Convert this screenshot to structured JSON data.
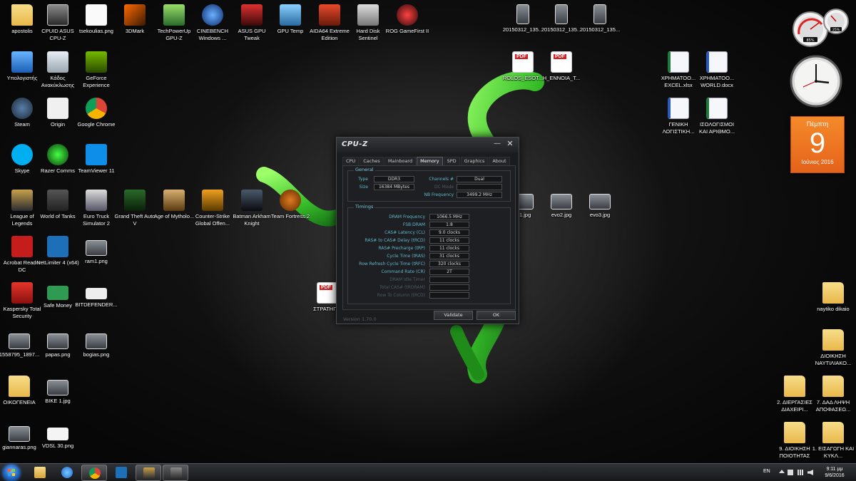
{
  "desktop_icons": {
    "apostolis": "apostolis",
    "cpuid": "CPUID ASUS CPU-Z",
    "tsekoulias": "tsekoulias.png",
    "mark3d": "3DMark",
    "gpuz": "TechPowerUp GPU-Z",
    "cinebench": "CINEBENCH Windows ...",
    "asusgpu": "ASUS GPU Tweak",
    "gputemp": "GPU Temp",
    "aida": "AIDA64 Extreme Edition",
    "hds": "Hard Disk Sentinel",
    "rog": "ROG GameFirst II",
    "img1": "20150312_135...",
    "img2": "20150312_135...",
    "img3": "20150312_135...",
    "computer": "Υπολογιστής",
    "recycle": "Κάδος Ανακύκλωσης",
    "geforce": "GeForce Experience",
    "rolos": "ROLOS_ESOT...",
    "ennoia": "H_ENNOIA_T...",
    "xrim_excel": "ΧΡΗΜΑΤΟΟ... EXCEL.xlsx",
    "xrim_word": "ΧΡΗΜΑΤΟΟ... WORLD.docx",
    "steam": "Steam",
    "origin": "Origin",
    "chrome": "Google Chrome",
    "geniki": "ΓΕΝΙΚΗ ΛΟΓΙΣΤΙΚΗ...",
    "isologismoi": "ΙΣΟΛΟΓΙΣΜΟΙ ΚΑΙ ΑΡΙΘΜΟ...",
    "skype": "Skype",
    "razer": "Razer Comms",
    "teamviewer": "TeamViewer 11",
    "lol": "League of Legends",
    "wot": "World of Tanks",
    "ets": "Euro Truck Simulator 2",
    "gta": "Grand Theft Auto V",
    "aom": "Age of Mytholo...",
    "csgo": "Counter-Strike Global Offen...",
    "batman": "Batman Arkham Knight",
    "tf2": "Team Fortress 2",
    "evo1": "...1.jpg",
    "evo2": "evo2.jpg",
    "evo3": "evo3.jpg",
    "acrobat": "Acrobat Reader DC",
    "netlimiter": "NetLimiter 4 (x64)",
    "ram1": "ram1.png",
    "kaspersky": "Kaspersky Total Security",
    "safemoney": "Safe Money",
    "bitdefender": "BITDEFENDER...",
    "stratip": "ΣΤΡΑΤΗΠ...",
    "naytiko": "naytiko dikaio",
    "photo1558": "1558795_1897...",
    "papas": "papas.png",
    "bogias": "bogias.png",
    "dioikisi_nayt": "ΔΙΟΙΚΗΣΗ ΝΑΥΤΙΛΙΑΚΟ...",
    "oikogeneia": "ΟΙΚΟΓΕΝΕΙΑ",
    "bike": "BIKE 1.jpg",
    "diergasies": "2. ΔΙΕΡΓΑΣΙΕΣ ΔΙΑΧΕΙΡΙ...",
    "lipsi": "7. ΔΑΔ ΛΗΨΗ ΑΠΟΦΑΣΕΩ...",
    "giannaras": "giannaras.png",
    "vdsl": "VDSL 30.png",
    "poiotita": "9. ΔΙΟΙΚΗΣΗ ΠΟΙΟΤΗΤΑΣ",
    "eisagogi": "1. ΕΙΣΑΓΩΓΗ ΚΑΙ ΚΥΚΛ..."
  },
  "gadgets": {
    "meter_a": "85%",
    "meter_b": "25%",
    "cal_day": "Πέμπτη",
    "cal_num": "9",
    "cal_month": "Ιούνιος 2016"
  },
  "cpuz": {
    "title": "CPU-Z",
    "tabs": [
      "CPU",
      "Caches",
      "Mainboard",
      "Memory",
      "SPD",
      "Graphics",
      "About"
    ],
    "general_title": "General",
    "type_label": "Type",
    "type_value": "DDR3",
    "size_label": "Size",
    "size_value": "16384 MBytes",
    "channels_label": "Channels #",
    "channels_value": "Dual",
    "dcmode_label": "DC Mode",
    "nbfreq_label": "NB Frequency",
    "nbfreq_value": "3499.2 MHz",
    "timings_title": "Timings",
    "timings": [
      {
        "label": "DRAM Frequency",
        "value": "1066.5 MHz"
      },
      {
        "label": "FSB:DRAM",
        "value": "1:8"
      },
      {
        "label": "CAS# Latency (CL)",
        "value": "9.0 clocks"
      },
      {
        "label": "RAS# to CAS# Delay (tRCD)",
        "value": "11 clocks"
      },
      {
        "label": "RAS# Precharge (tRP)",
        "value": "11 clocks"
      },
      {
        "label": "Cycle Time (tRAS)",
        "value": "31 clocks"
      },
      {
        "label": "Row Refresh Cycle Time (tRFC)",
        "value": "320 clocks"
      },
      {
        "label": "Command Rate (CR)",
        "value": "2T"
      },
      {
        "label": "DRAM Idle Timer",
        "value": ""
      },
      {
        "label": "Total CAS# (tRDRAM)",
        "value": ""
      },
      {
        "label": "Row To Column (tRCD)",
        "value": ""
      }
    ],
    "version": "Version 1.70.0",
    "validate": "Validate",
    "ok": "OK"
  },
  "taskbar": {
    "lang": "EN",
    "time": "9:11 μμ",
    "date": "9/6/2016"
  },
  "colors": {
    "accent_cyan": "#5fb6cc",
    "calendar_orange": "#e4621a",
    "snake_green": "#3fd13a"
  }
}
